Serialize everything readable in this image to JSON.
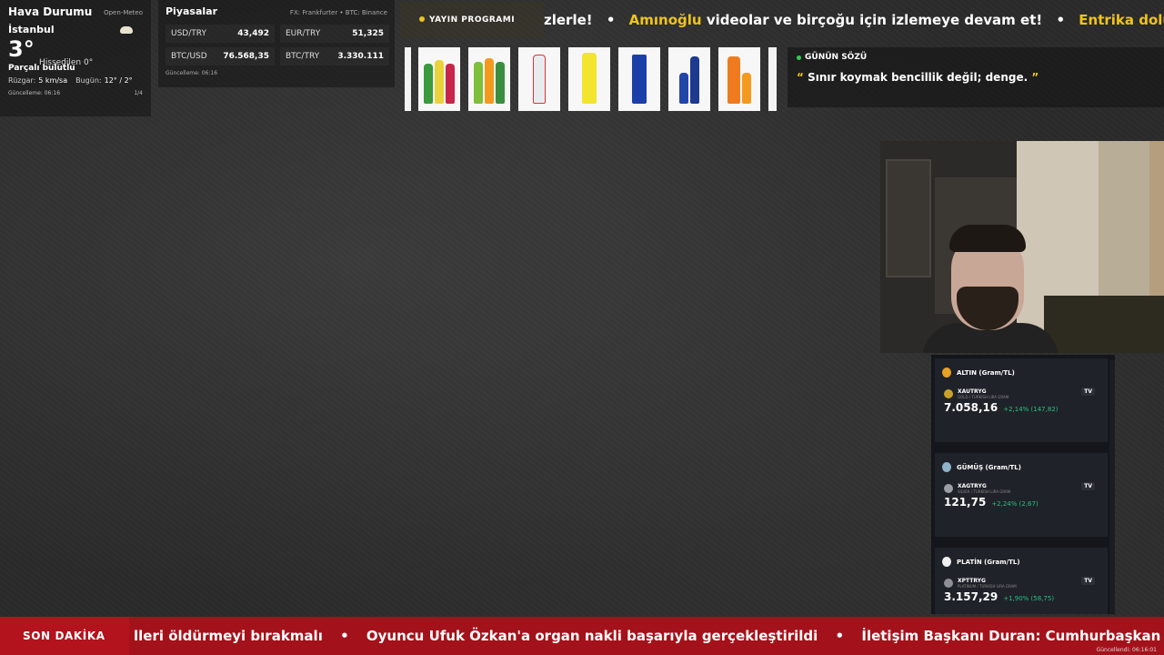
{
  "weather": {
    "title": "Hava Durumu",
    "source": "Open-Meteo",
    "city": "İstanbul",
    "temp": "3°",
    "feels": "Hissedilen 0°",
    "desc": "Parçalı bulutlu",
    "wind_label": "Rüzgar:",
    "wind": "5 km/sa",
    "today_label": "Bugün:",
    "today": "12° / 2°",
    "updated": "Güncelleme: 06:16",
    "page": "1/4",
    "icon": "partly-cloudy-icon"
  },
  "markets": {
    "title": "Piyasalar",
    "source": "FX: Frankfurter • BTC: Binance",
    "items": [
      {
        "label": "USD/TRY",
        "value": "43,492"
      },
      {
        "label": "EUR/TRY",
        "value": "51,325"
      },
      {
        "label": "BTC/USD",
        "value": "76.568,35"
      },
      {
        "label": "BTC/TRY",
        "value": "3.330.111"
      }
    ],
    "updated": "Güncelleme: 06:16"
  },
  "schedule": {
    "label": "YAYIN PROGRAMI"
  },
  "ticker": {
    "part1": "zlerle!",
    "sep": "•",
    "part2_a": "Amınoğlu",
    "part2_b": "videolar ve birçoğu için izlemeye devam et!",
    "part3": "Entrika dolu Kısmet"
  },
  "quote": {
    "title": "GÜNÜN SÖZÜ",
    "open": "“",
    "text": "Sınır koymak bencillik değil; denge.",
    "close": "”"
  },
  "metals": [
    {
      "title": "ALTIN (Gram/TL)",
      "symbol": "XAUTRYG",
      "desc": "GOLD / TURKISH LIRA GRAM",
      "price": "7.058,16",
      "change": "+2,14% (147,82)",
      "medal_color": "#e7a124",
      "coin_color": "#c9a227"
    },
    {
      "title": "GÜMÜŞ (Gram/TL)",
      "symbol": "XAGTRYG",
      "desc": "SILVER / TURKISH LIRA GRAM",
      "price": "121,75",
      "change": "+2,24% (2,67)",
      "medal_color": "#8fb3c9",
      "coin_color": "#9aa0a6"
    },
    {
      "title": "PLATİN (Gram/TL)",
      "symbol": "XPTTRYG",
      "desc": "PLATINUM / TURKISH LIRA GRAM",
      "price": "3.157,29",
      "change": "+1,90% (58,75)",
      "medal_color": "#f0f0f0",
      "coin_color": "#8d9096"
    }
  ],
  "metals_tv": "TV",
  "news": {
    "label": "SON DAKİKA",
    "text_1": "lleri öldürmeyi bırakmalı",
    "sep": "•",
    "text_2": "Oyuncu Ufuk Özkan'a organ nakli başarıyla gerçekleştirildi",
    "text_3": "İletişim Başkanı Duran: Cumhurbaşkan",
    "updated": "Güncellendi: 06:16:01"
  },
  "colors": {
    "accent": "#f0c419",
    "news_red": "#a3121a",
    "positive": "#26c281"
  }
}
